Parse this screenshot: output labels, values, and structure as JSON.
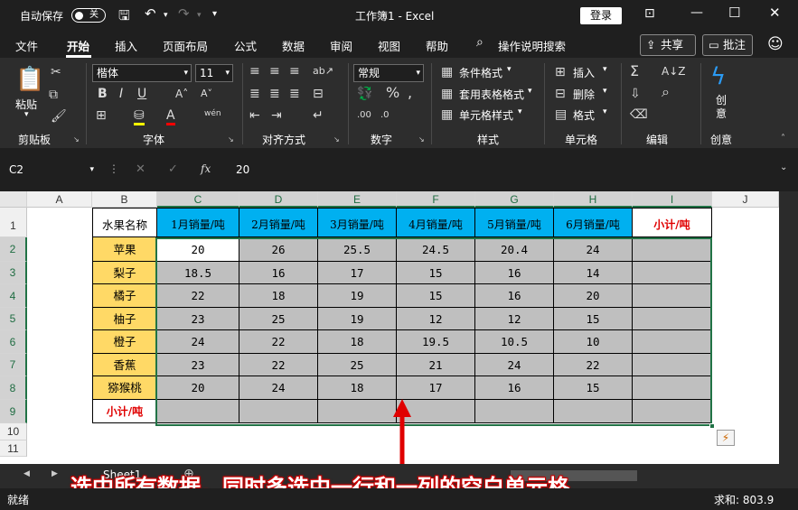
{
  "titlebar": {
    "autosave_label": "自动保存",
    "autosave_state": "关",
    "title": "工作簿1  -  Excel",
    "login_label": "登录"
  },
  "tabs": [
    {
      "label": "文件"
    },
    {
      "label": "开始"
    },
    {
      "label": "插入"
    },
    {
      "label": "页面布局"
    },
    {
      "label": "公式"
    },
    {
      "label": "数据"
    },
    {
      "label": "审阅"
    },
    {
      "label": "视图"
    },
    {
      "label": "帮助"
    },
    {
      "label": "操作说明搜索"
    }
  ],
  "share_label": "共享",
  "comment_label": "批注",
  "ribbon": {
    "paste_label": "粘贴",
    "font_name": "楷体",
    "font_size": "11",
    "number_format": "常规",
    "conditional_format": "条件格式",
    "table_format": "套用表格格式",
    "cell_style": "单元格样式",
    "insert": "插入",
    "delete": "删除",
    "format": "格式",
    "idea_label": "创意",
    "groups": [
      "剪贴板",
      "字体",
      "对齐方式",
      "数字",
      "样式",
      "单元格",
      "编辑",
      "创意"
    ]
  },
  "formula_bar": {
    "name_box": "C2",
    "fx": "fx",
    "value": "20"
  },
  "sheet": {
    "columns": [
      "A",
      "B",
      "C",
      "D",
      "E",
      "F",
      "G",
      "H",
      "I",
      "J"
    ],
    "rows": [
      "1",
      "2",
      "3",
      "4",
      "5",
      "6",
      "7",
      "8",
      "9",
      "10",
      "11"
    ],
    "header_row": [
      "水果名称",
      "1月销量/吨",
      "2月销量/吨",
      "3月销量/吨",
      "4月销量/吨",
      "5月销量/吨",
      "6月销量/吨",
      "小计/吨"
    ],
    "fruits": [
      "苹果",
      "梨子",
      "橘子",
      "柚子",
      "橙子",
      "香蕉",
      "猕猴桃"
    ],
    "values": [
      [
        "20",
        "26",
        "25.5",
        "24.5",
        "20.4",
        "24"
      ],
      [
        "18.5",
        "16",
        "17",
        "15",
        "16",
        "14"
      ],
      [
        "22",
        "18",
        "19",
        "15",
        "16",
        "20"
      ],
      [
        "23",
        "25",
        "19",
        "12",
        "12",
        "15"
      ],
      [
        "24",
        "22",
        "18",
        "19.5",
        "10.5",
        "10"
      ],
      [
        "23",
        "22",
        "25",
        "21",
        "24",
        "22"
      ],
      [
        "20",
        "24",
        "18",
        "17",
        "16",
        "15"
      ]
    ],
    "total_label": "小计/吨"
  },
  "sheet_tab": "Sheet1",
  "status": {
    "ready": "就绪",
    "sum": "求和: 803.9"
  },
  "caption": "选中所有数据，同时多选中一行和一列的空白单元格",
  "colors": {
    "header_blue": "#00b0f0",
    "name_yellow": "#ffd966",
    "selection_gray": "#bfbfbf",
    "accent_green": "#217346",
    "total_red": "#e00000"
  }
}
